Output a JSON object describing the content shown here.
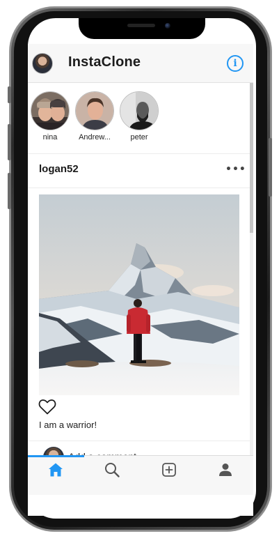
{
  "header": {
    "title": "InstaClone",
    "avatar_icon": "user-avatar",
    "info_icon": "info-icon",
    "info_symbol": "i",
    "accent_color": "#2196f3"
  },
  "stories": [
    {
      "label": "nina"
    },
    {
      "label": "Andrew..."
    },
    {
      "label": "peter"
    }
  ],
  "post": {
    "username": "logan52",
    "more_symbol": "•••",
    "image_icon": "mountain-photo",
    "caption": "I am a warrior!",
    "like_icon": "heart-outline-icon"
  },
  "comment": {
    "text": "Add a comment..."
  },
  "tabbar": {
    "active_tab": "home",
    "tabs": [
      {
        "name": "home",
        "icon": "home-icon"
      },
      {
        "name": "search",
        "icon": "search-icon"
      },
      {
        "name": "add",
        "icon": "add-post-icon"
      },
      {
        "name": "profile",
        "icon": "profile-icon"
      }
    ]
  }
}
